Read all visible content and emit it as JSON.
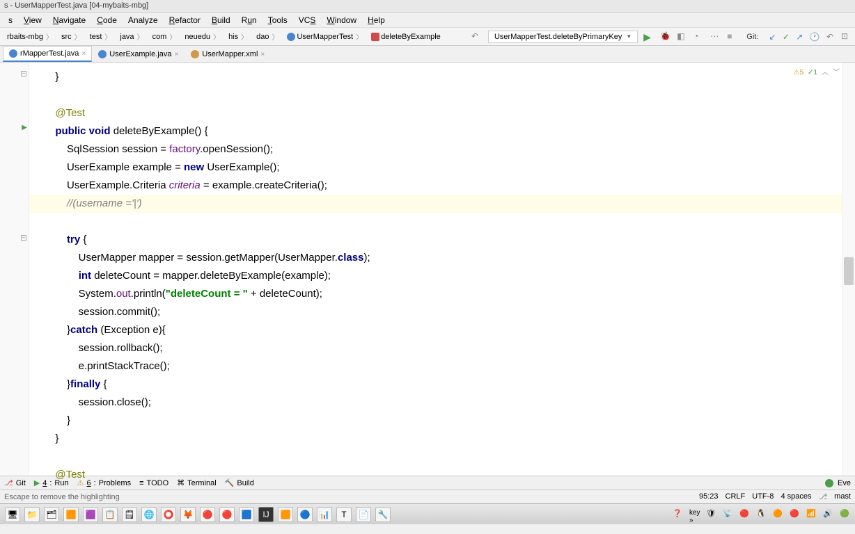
{
  "title": "s - UserMapperTest.java [04-mybaits-mbg]",
  "menu": [
    "s",
    "View",
    "Navigate",
    "Code",
    "Analyze",
    "Refactor",
    "Build",
    "Run",
    "Tools",
    "VCS",
    "Window",
    "Help"
  ],
  "breadcrumb": [
    "rbaits-mbg",
    "src",
    "test",
    "java",
    "com",
    "neuedu",
    "his",
    "dao",
    "UserMapperTest",
    "deleteByExample"
  ],
  "run_config": "UserMapperTest.deleteByPrimaryKey",
  "git_label": "Git:",
  "tabs": [
    {
      "label": "rMapperTest.java",
      "active": true,
      "type": "java"
    },
    {
      "label": "UserExample.java",
      "active": false,
      "type": "java"
    },
    {
      "label": "UserMapper.xml",
      "active": false,
      "type": "xml"
    }
  ],
  "inspection": {
    "warn": "5",
    "ok": "1"
  },
  "code": {
    "l1": "        }",
    "l3_anno": "        @Test",
    "l4_p1": "        public void ",
    "l4_m": "deleteByExample",
    "l4_p2": "() {",
    "l5_p1": "            SqlSession session = ",
    "l5_f": "factory",
    "l5_p2": ".openSession();",
    "l6_p1": "            UserExample example = ",
    "l6_kw": "new ",
    "l6_p2": "UserExample();",
    "l7_p1": "            UserExample.Criteria ",
    "l7_i": "criteria",
    "l7_p2": " = example.createCriteria();",
    "l8": "            //(username ='|')",
    "l10_p1": "            try ",
    "l10_p2": "{",
    "l11_p1": "                UserMapper mapper = session.getMapper(UserMapper.",
    "l11_kw": "class",
    "l11_p2": ");",
    "l12_p1": "                ",
    "l12_kw": "int ",
    "l12_p2": "deleteCount = mapper.deleteByExample(example);",
    "l13_p1": "                System.",
    "l13_f": "out",
    "l13_p2": ".println(",
    "l13_s": "\"deleteCount = \"",
    "l13_p3": " + deleteCount);",
    "l14": "                session.commit();",
    "l15_p1": "            }",
    "l15_kw": "catch ",
    "l15_p2": "(Exception e){",
    "l16": "                session.rollback();",
    "l17": "                e.printStackTrace();",
    "l18_p1": "            }",
    "l18_kw": "finally ",
    "l18_p2": "{",
    "l19": "                session.close();",
    "l20": "            }",
    "l21": "        }",
    "l23_anno": "        @Test"
  },
  "bottom_tools": {
    "git": "Git",
    "run_num": "4",
    "run": "Run",
    "prob_num": "6",
    "prob": "Problems",
    "todo": "TODO",
    "terminal": "Terminal",
    "build": "Build",
    "event": "Eve"
  },
  "status": {
    "hint": "Escape to remove the highlighting",
    "pos": "95:23",
    "eol": "CRLF",
    "enc": "UTF-8",
    "indent": "4 spaces",
    "branch": "mast"
  },
  "tray": {
    "key": "key",
    "arrow": "»"
  }
}
